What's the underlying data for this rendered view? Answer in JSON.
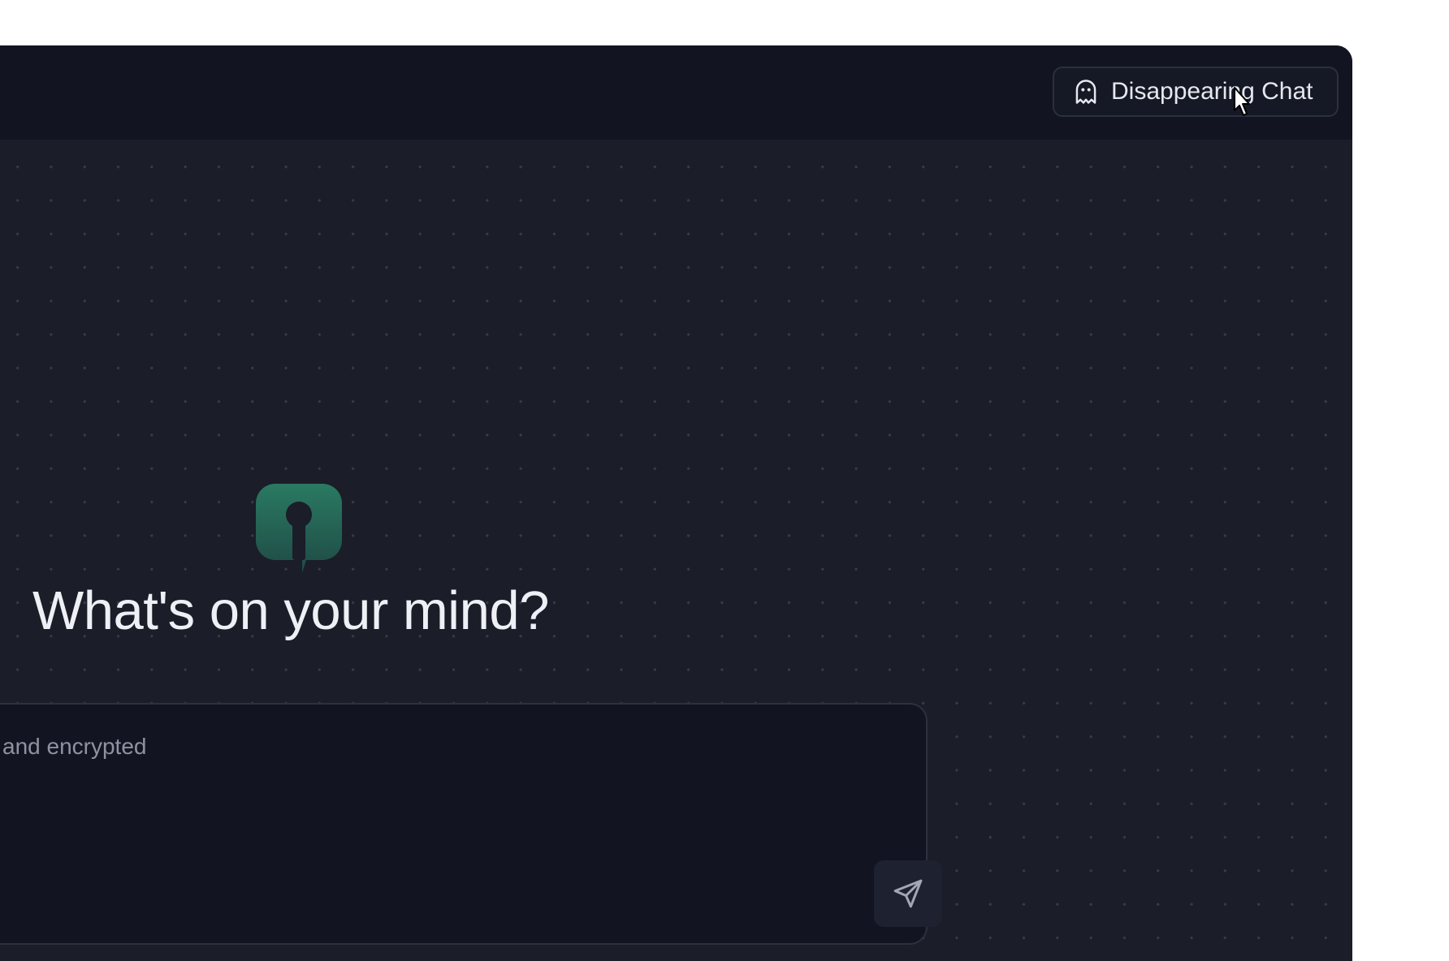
{
  "header": {
    "disappearing_chat_label": "Disappearing Chat",
    "disappearing_chat_icon": "ghost-icon"
  },
  "main": {
    "logo_icon": "keyhole-chat-logo",
    "headline": "What's on your mind?"
  },
  "composer": {
    "placeholder": "and encrypted",
    "value": "",
    "send_icon": "send-icon"
  },
  "colors": {
    "background": "#1b1d29",
    "top_bar": "#121521",
    "composer_bg": "#121521",
    "logo_gradient_top": "#2a7a62",
    "logo_gradient_bottom": "#1f4a45",
    "text_primary": "#eef0f5",
    "text_muted": "#8e92a1"
  }
}
